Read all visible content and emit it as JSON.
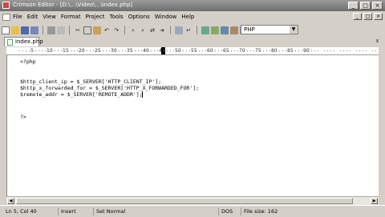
{
  "window": {
    "title": "Crimson Editor - [D:\\...\\Video\\...\\index.php]",
    "minimize": "_",
    "maximize": "□",
    "close": "×"
  },
  "menu": [
    "File",
    "Edit",
    "View",
    "Format",
    "Project",
    "Tools",
    "Options",
    "Window",
    "Help"
  ],
  "toolbar": {
    "language": "PHP",
    "icons": [
      "new-file-icon",
      "open-folder-icon",
      "save-icon",
      "save-all-icon",
      "print-icon",
      "print-preview-icon",
      "cut-icon",
      "copy-icon",
      "paste-icon",
      "undo-icon",
      "redo-icon",
      "find-icon",
      "find-next-icon",
      "replace-icon",
      "goto-icon",
      "spell-check-icon",
      "wrap-icon",
      "tool-1-icon",
      "tool-2-icon",
      "tool-3-icon",
      "tool-4-icon",
      "tool-5-icon"
    ]
  },
  "tab": {
    "label": "index.php",
    "close": "x"
  },
  "ruler": {
    "labels": [
      "5",
      "10",
      "15",
      "20",
      "25",
      "30",
      "35",
      "40",
      "45",
      "50",
      "55",
      "60",
      "65",
      "70",
      "75",
      "80",
      "85",
      "90"
    ]
  },
  "editor": {
    "lines": [
      "<?php",
      "",
      "$http_client_ip = $_SERVER['HTTP_CLIENT_IP'];",
      "$http_x_forwarded_for = $_SERVER['HTTP_X_FORWARDED_FOR'];",
      "$remote_addr = $_SERVER['REMOTE_ADDR'];",
      "",
      "",
      "?>"
    ]
  },
  "status": {
    "position": "Ln 5, Col 40",
    "mode": "Insert",
    "format": "Set Normal",
    "encoding": "DOS",
    "filesize": "File size: 162"
  }
}
